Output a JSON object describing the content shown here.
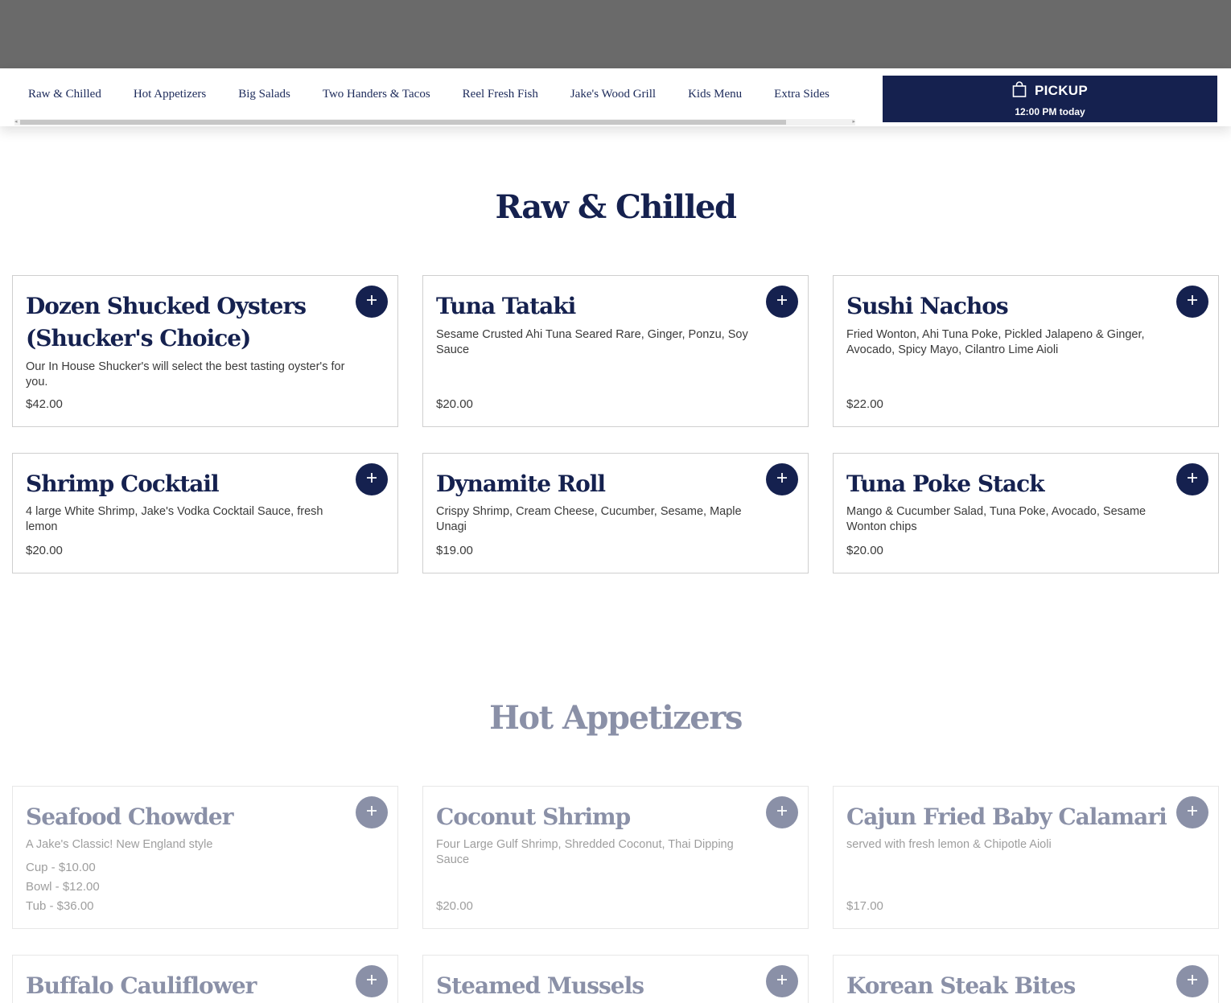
{
  "nav": {
    "items": [
      "Raw & Chilled",
      "Hot Appetizers",
      "Big Salads",
      "Two Handers & Tacos",
      "Reel Fresh Fish",
      "Jake's Wood Grill",
      "Kids Menu",
      "Extra Sides"
    ],
    "pickup": {
      "icon": "shopping-bag-icon",
      "label": "PICKUP",
      "time": "12:00 PM today"
    }
  },
  "sections": {
    "raw": {
      "title": "Raw & Chilled",
      "items": [
        {
          "name": "Dozen Shucked Oysters (Shucker's Choice)",
          "desc": "Our In House Shucker's will select the best tasting oyster's for you.",
          "price": "$42.00"
        },
        {
          "name": "Tuna Tataki",
          "desc": "Sesame Crusted Ahi Tuna Seared Rare, Ginger, Ponzu, Soy Sauce",
          "price": "$20.00"
        },
        {
          "name": "Sushi Nachos",
          "desc": "Fried Wonton, Ahi Tuna Poke, Pickled Jalapeno & Ginger, Avocado, Spicy Mayo, Cilantro Lime Aioli",
          "price": "$22.00"
        },
        {
          "name": "Shrimp Cocktail",
          "desc": "4 large White Shrimp, Jake's Vodka Cocktail Sauce, fresh lemon",
          "price": "$20.00"
        },
        {
          "name": "Dynamite Roll",
          "desc": "Crispy Shrimp, Cream Cheese, Cucumber, Sesame, Maple Unagi",
          "price": "$19.00"
        },
        {
          "name": "Tuna Poke Stack",
          "desc": "Mango & Cucumber Salad, Tuna Poke, Avocado, Sesame Wonton chips",
          "price": "$20.00"
        }
      ]
    },
    "hot": {
      "title": "Hot Appetizers",
      "items": [
        {
          "name": "Seafood Chowder",
          "desc": "A Jake's Classic! New England style",
          "prices": [
            "Cup - $10.00",
            "Bowl - $12.00",
            "Tub - $36.00"
          ]
        },
        {
          "name": "Coconut Shrimp",
          "desc": "Four Large Gulf Shrimp, Shredded Coconut, Thai Dipping Sauce",
          "price": "$20.00"
        },
        {
          "name": "Cajun Fried Baby Calamari",
          "desc": "served with fresh lemon & Chipotle Aioli",
          "price": "$17.00"
        },
        {
          "name": "Buffalo Cauliflower"
        },
        {
          "name": "Steamed Mussels"
        },
        {
          "name": "Korean Steak Bites"
        }
      ]
    }
  },
  "colors": {
    "navy": "#15214f",
    "overlay": "#6a6a6a",
    "card_border": "#cfcfcf"
  }
}
